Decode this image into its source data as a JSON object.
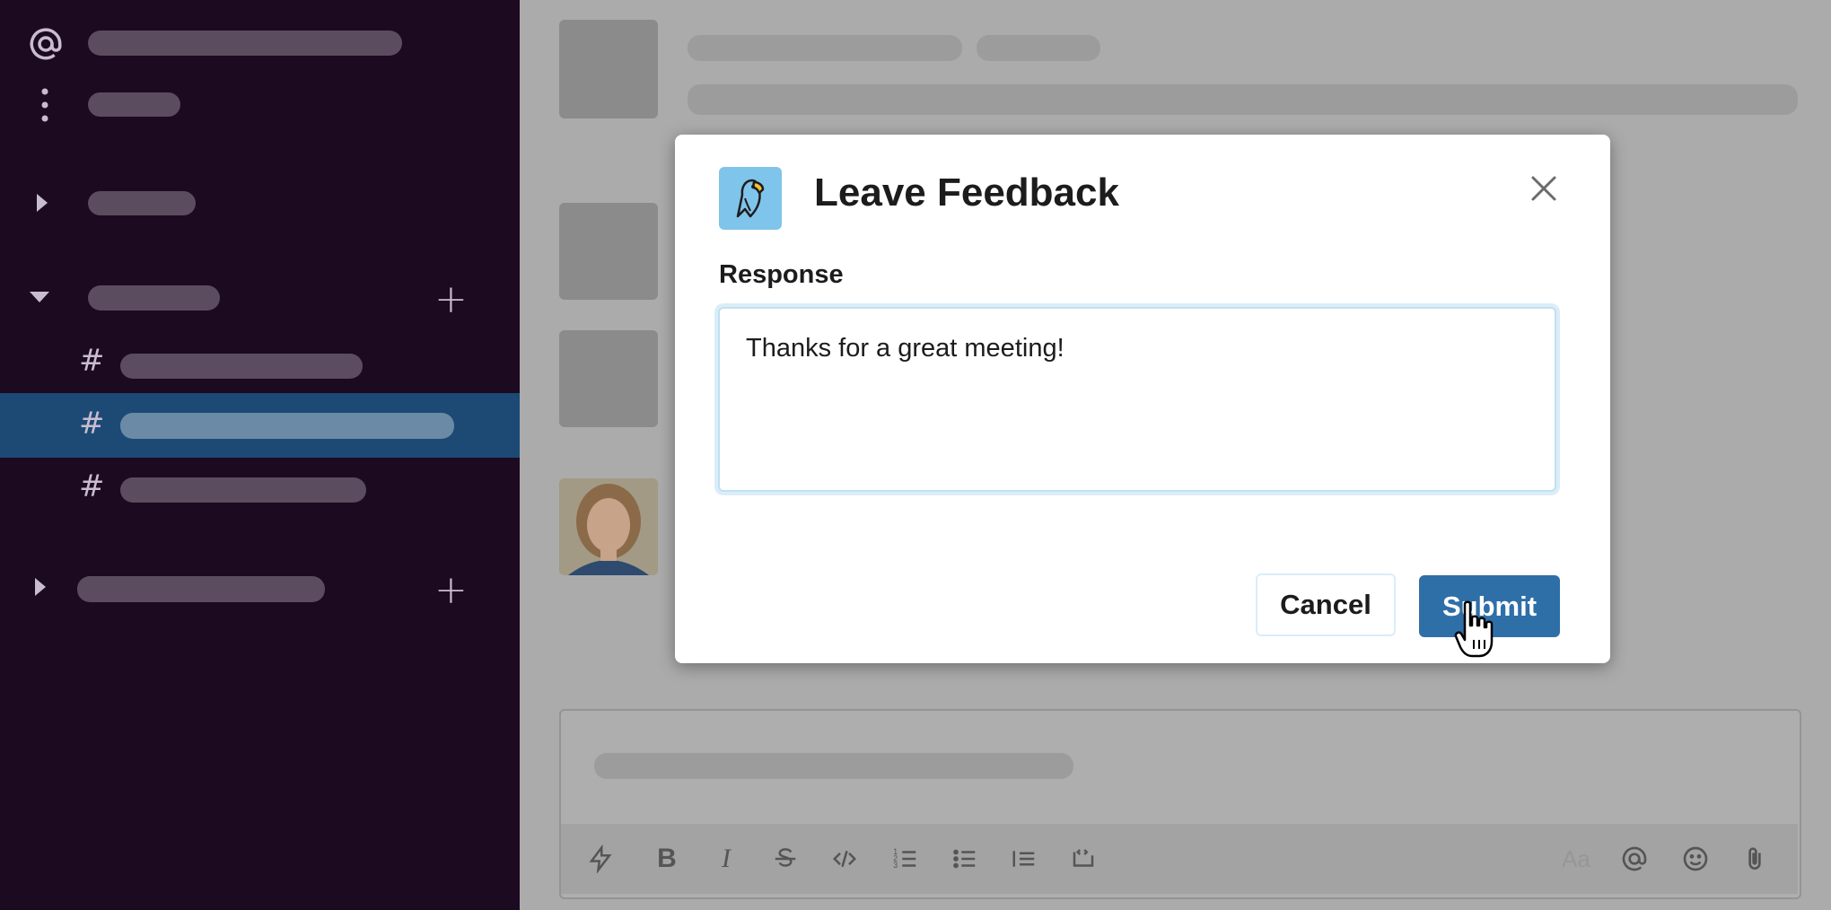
{
  "sidebar": {
    "icons": [
      "at-icon",
      "more-vertical-icon",
      "caret-right-icon",
      "caret-down-icon",
      "plus-icon",
      "caret-right-icon",
      "plus-icon"
    ],
    "channel_prefix": "#",
    "active_color": "#1c4a75",
    "background": "#1c0a21"
  },
  "modal": {
    "title": "Leave Feedback",
    "app_icon": "parrot-icon",
    "response_label": "Response",
    "response_value": "Thanks for a great meeting!",
    "cancel_label": "Cancel",
    "submit_label": "Submit",
    "submit_color": "#2f6fa8"
  },
  "composer": {
    "toolbar_icons": [
      "lightning-icon",
      "bold-icon",
      "italic-icon",
      "strikethrough-icon",
      "code-icon",
      "ordered-list-icon",
      "bulleted-list-icon",
      "blockquote-icon",
      "code-block-icon",
      "text-format-icon",
      "mention-icon",
      "emoji-icon",
      "attachment-icon"
    ],
    "bold_glyph": "B",
    "italic_glyph": "I",
    "format_glyph": "Aa"
  }
}
